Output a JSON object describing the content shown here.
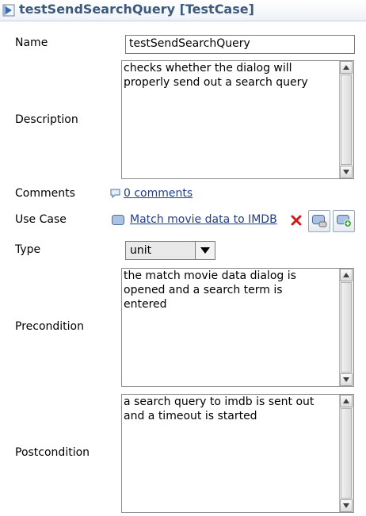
{
  "header": {
    "title": "testSendSearchQuery [TestCase]",
    "icon": "testcase-icon"
  },
  "fields": {
    "name": {
      "label": "Name",
      "value": "testSendSearchQuery"
    },
    "description": {
      "label": "Description",
      "value": "checks whether the dialog will\nproperly send out a search query"
    },
    "comments": {
      "label": "Comments",
      "link": "0 comments"
    },
    "use_case": {
      "label": "Use Case",
      "link": "Match movie data to IMDB"
    },
    "type": {
      "label": "Type",
      "value": "unit"
    },
    "precondition": {
      "label": "Precondition",
      "value": "the match movie data dialog is\nopened and a search term is\nentered"
    },
    "postcondition": {
      "label": "Postcondition",
      "value": "a search query to imdb is sent out\nand a timeout is started"
    }
  },
  "colors": {
    "title": "#3d5a7c",
    "link": "#1f3d8a",
    "remove": "#d11a1a"
  }
}
